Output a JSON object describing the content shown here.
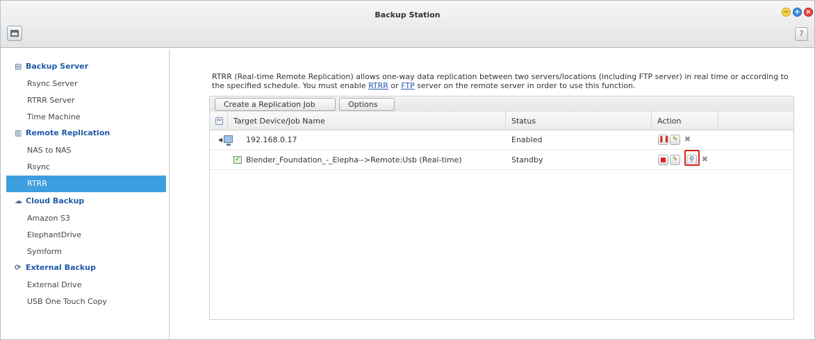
{
  "window": {
    "title": "Backup Station",
    "help_label": "?"
  },
  "sidebar": {
    "sections": [
      {
        "label": "Backup Server",
        "icon": "server-icon",
        "items": [
          "Rsync Server",
          "RTRR Server",
          "Time Machine"
        ]
      },
      {
        "label": "Remote Replication",
        "icon": "replication-icon",
        "items": [
          "NAS to NAS",
          "Rsync",
          "RTRR"
        ]
      },
      {
        "label": "Cloud Backup",
        "icon": "cloud-icon",
        "items": [
          "Amazon S3",
          "ElephantDrive",
          "Symform"
        ]
      },
      {
        "label": "External Backup",
        "icon": "sync-icon",
        "items": [
          "External Drive",
          "USB One Touch Copy"
        ]
      }
    ],
    "active_item": "RTRR"
  },
  "main": {
    "description_part1": "RTRR (Real-time Remote Replication) allows one-way data replication between two servers/locations (including FTP server) in real time or according to the specified schedule. You must enable ",
    "link_rtrr": "RTRR",
    "description_or": " or ",
    "link_ftp": "FTP",
    "description_part2": " server on the remote server in order to use this function.",
    "toolbar": {
      "create_label": "Create a Replication Job",
      "options_label": "Options"
    },
    "table": {
      "columns": [
        "Target Device/Job Name",
        "Status",
        "Action"
      ],
      "rows": [
        {
          "name": "192.168.0.17",
          "status": "Enabled",
          "type": "device"
        },
        {
          "name": "Blender_Foundation_-_Elepha-->Remote:Usb (Real-time)",
          "status": "Standby",
          "type": "job"
        }
      ]
    }
  },
  "colors": {
    "accent": "#3d9fdf",
    "section_text": "#1f5aa6",
    "link": "#1f56b5",
    "highlight": "#d3271f"
  }
}
